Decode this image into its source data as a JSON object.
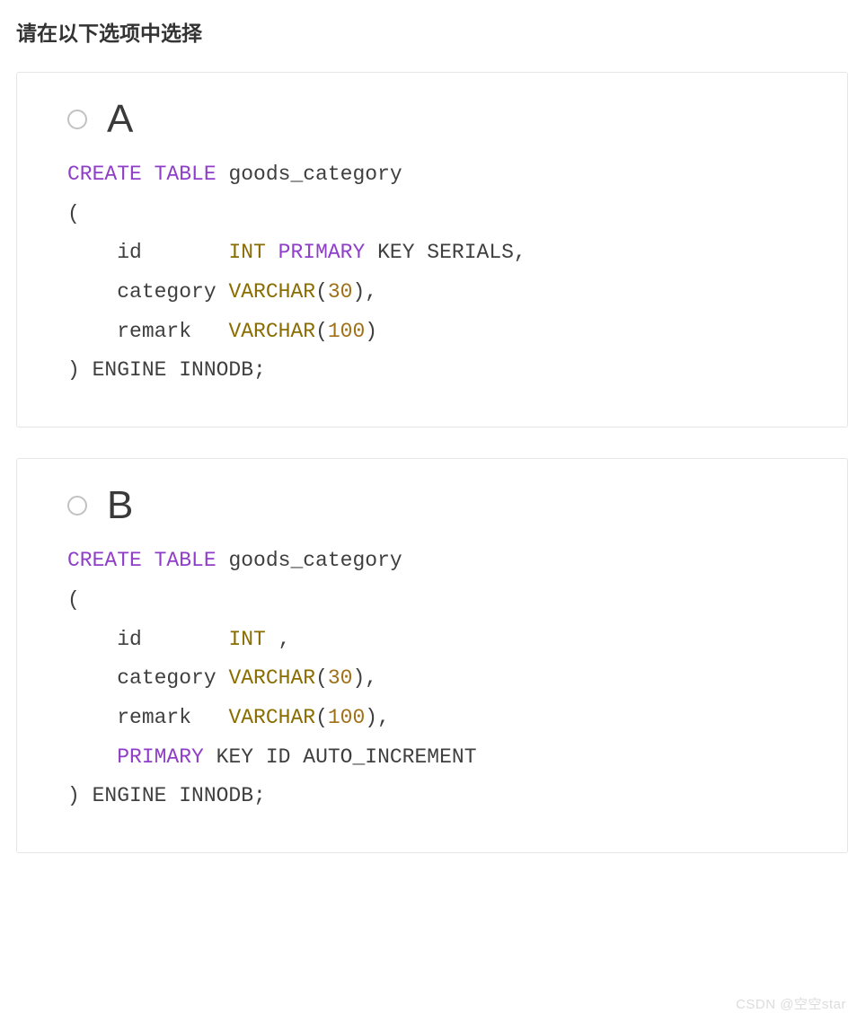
{
  "prompt": "请在以下选项中选择",
  "watermark": "CSDN @空空star",
  "options": [
    {
      "letter": "A",
      "code": {
        "l1": {
          "kw": "CREATE TABLE",
          "rest": " goods_category"
        },
        "l2": "(",
        "l3": {
          "indent": "    id       ",
          "type1": "INT",
          "sp": " ",
          "kw": "PRIMARY",
          "rest": " KEY SERIALS,"
        },
        "l4": {
          "indent": "    category ",
          "type": "VARCHAR",
          "open": "(",
          "num": "30",
          "close": "),"
        },
        "l5": {
          "indent": "    remark   ",
          "type": "VARCHAR",
          "open": "(",
          "num": "100",
          "close": ")"
        },
        "l6": ") ENGINE INNODB;"
      }
    },
    {
      "letter": "B",
      "code": {
        "l1": {
          "kw": "CREATE TABLE",
          "rest": " goods_category"
        },
        "l2": "(",
        "l3": {
          "indent": "    id       ",
          "type1": "INT",
          "rest": " ,"
        },
        "l4": {
          "indent": "    category ",
          "type": "VARCHAR",
          "open": "(",
          "num": "30",
          "close": "),"
        },
        "l5": {
          "indent": "    remark   ",
          "type": "VARCHAR",
          "open": "(",
          "num": "100",
          "close": "),"
        },
        "l6": {
          "indent": "    ",
          "kw": "PRIMARY",
          "rest": " KEY ID AUTO_INCREMENT"
        },
        "l7": ") ENGINE INNODB;"
      }
    }
  ]
}
